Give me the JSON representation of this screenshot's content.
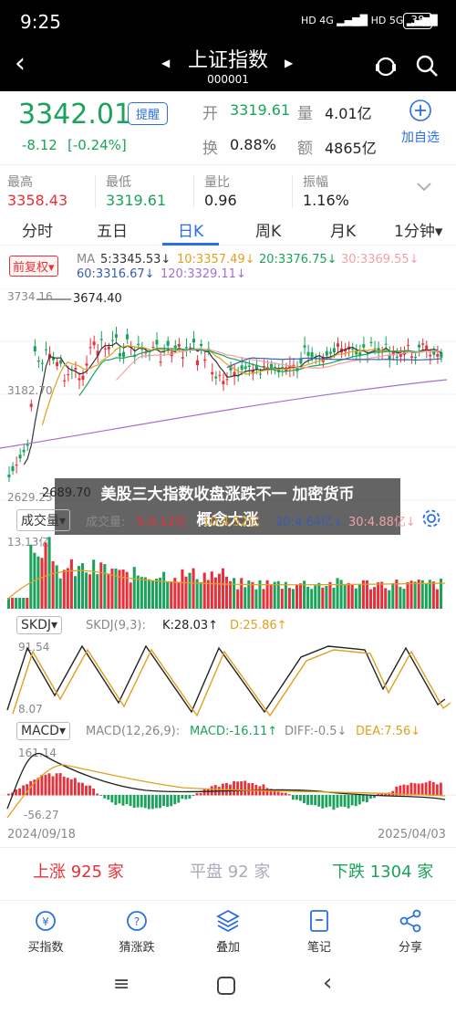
{
  "status": {
    "time": "9:25",
    "battery": "38",
    "net1": "4G",
    "net2": "5G"
  },
  "title": {
    "name": "上证指数",
    "code": "000001"
  },
  "quote": {
    "price": "3342.01",
    "remind": "提醒",
    "change": "-8.12",
    "change_pct": "[-0.24%]",
    "open_label": "开",
    "open": "3319.61",
    "vol_label": "量",
    "vol": "4.01亿",
    "turn_label": "换",
    "turn": "0.88%",
    "amt_label": "额",
    "amt": "4865亿",
    "add_label": "加自选",
    "high_label": "最高",
    "high": "3358.43",
    "low_label": "最低",
    "low": "3319.61",
    "ratio_label": "量比",
    "ratio": "0.96",
    "amp_label": "振幅",
    "amp": "1.16%"
  },
  "tabs": [
    "分时",
    "五日",
    "日K",
    "周K",
    "月K",
    "1分钟"
  ],
  "kline": {
    "adj": "前复权",
    "ma_label": "MA",
    "ma5": "5:3345.53↓",
    "ma10": "10:3357.49↓",
    "ma20": "20:3376.75↓",
    "ma30": "30:3369.55↓",
    "ma60": "60:3316.67↓",
    "ma120": "120:3329.11↓",
    "ytop": "3734.16",
    "ymid": "3182.70",
    "ylow": "2629.23",
    "high_mark": "3674.40",
    "low_mark": "2689.70"
  },
  "overlay": {
    "line1": "美股三大指数收盘涨跌不一 加密货币",
    "line2": "概念大涨"
  },
  "volume": {
    "name": "成交量",
    "label": "成交量:",
    "v5": "5:4.12亿",
    "v10": "10:4.52亿",
    "v20": "20:4.64亿↓",
    "v30": "30:4.88亿↓",
    "ymax": "13.13亿"
  },
  "skdj": {
    "name": "SKDJ",
    "params": "SKDJ(9,3):",
    "k": "K:28.03↑",
    "d": "D:25.86↑",
    "ytop": "91.54",
    "ybot": "8.07"
  },
  "macd": {
    "name": "MACD",
    "params": "MACD(12,26,9):",
    "macd": "MACD:-16.11↑",
    "diff": "DIFF:-0.5↓",
    "dea": "DEA:7.56↓",
    "ytop": "161.14",
    "ybot": "-56.27"
  },
  "dates": {
    "start": "2024/09/18",
    "end": "2025/04/03"
  },
  "breadth": {
    "up": "上涨 925 家",
    "flat": "平盘 92 家",
    "down": "下跌 1304 家"
  },
  "nav": [
    "买指数",
    "猜涨跌",
    "叠加",
    "笔记",
    "分享"
  ],
  "colors": {
    "up": "#e8303a",
    "down": "#1aa35a",
    "accent": "#2a6ee8"
  }
}
